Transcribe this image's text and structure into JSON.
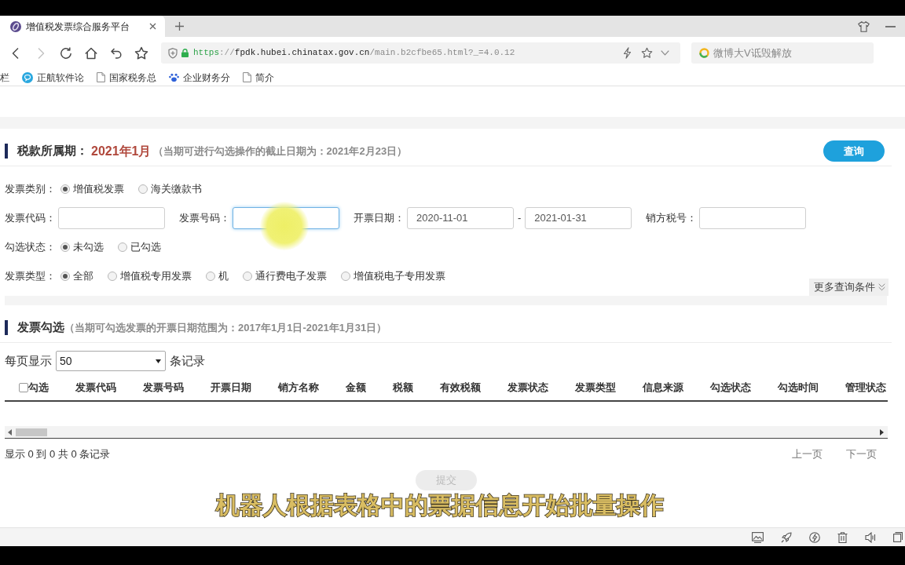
{
  "browser": {
    "tabs": [
      {
        "title": "增值税发票综合服务平台",
        "selected": true
      }
    ],
    "nav_buttons": [
      {
        "kind": "back",
        "disabled": false
      },
      {
        "kind": "forward",
        "disabled": true
      },
      {
        "kind": "reload",
        "disabled": false
      },
      {
        "kind": "home",
        "disabled": false
      },
      {
        "kind": "undo",
        "disabled": false
      },
      {
        "kind": "bookmark",
        "disabled": false
      }
    ],
    "address_bar": {
      "scheme": "https",
      "separator": "://",
      "host": "fpdk.hubei.chinatax.gov.cn",
      "path": "/main.b2cfbe65.html?_=4.0.12"
    },
    "search_box": {
      "placeholder": "微博大V诋毁解放"
    },
    "bookmarks": [
      {
        "kind": "text",
        "label": "栏"
      },
      {
        "kind": "chat",
        "label": "正航软件论"
      },
      {
        "kind": "page",
        "label": "国家税务总"
      },
      {
        "kind": "paw",
        "label": "企业财务分"
      },
      {
        "kind": "page",
        "label": "简介"
      }
    ]
  },
  "tax_period": {
    "label": "税款所属期：",
    "value": "2021年1月",
    "note": "（当期可进行勾选操作的截止日期为：2021年2月23日）",
    "query_button": "查询"
  },
  "filter_rows": [
    {
      "kind": "radio",
      "label": "发票类别：",
      "options": [
        {
          "label": "增值税发票",
          "selected": true
        },
        {
          "label": "海关缴款书",
          "selected": false
        }
      ]
    },
    {
      "kind": "inputs",
      "items": [
        {
          "kind": "field",
          "label": "发票代码：",
          "focused": false
        },
        {
          "kind": "field",
          "label": "发票号码：",
          "focused": true
        },
        {
          "kind": "field",
          "label": "开票日期：",
          "value": "2020-11-01",
          "focused": false
        },
        {
          "kind": "separator",
          "text": "-"
        },
        {
          "kind": "field",
          "value": "2021-01-31",
          "focused": false
        },
        {
          "kind": "field",
          "label": "销方税号：",
          "focused": false
        }
      ]
    },
    {
      "kind": "radio",
      "label": "勾选状态：",
      "options": [
        {
          "label": "未勾选",
          "selected": true
        },
        {
          "label": "已勾选",
          "selected": false
        }
      ]
    },
    {
      "kind": "radio",
      "label": "发票类型：",
      "options": [
        {
          "label": "全部",
          "selected": true
        },
        {
          "label": "增值税专用发票",
          "selected": false
        },
        {
          "label": "机",
          "selected": false
        },
        {
          "label": "通行费电子发票",
          "selected": false
        },
        {
          "label": "增值税电子专用发票",
          "selected": false
        }
      ]
    }
  ],
  "more_conditions_button": "更多查询条件",
  "invoice_selection": {
    "title": "发票勾选",
    "note": "（当期可勾选发票的开票日期范围为：2017年1月1日-2021年1月31日）",
    "page_size": {
      "prefix": "每页显示",
      "value": "50",
      "suffix": "条记录"
    },
    "table": {
      "select_all": {
        "label": "勾选",
        "checked": false
      },
      "columns": [
        "发票代码",
        "发票号码",
        "开票日期",
        "销方名称",
        "金额",
        "税额",
        "有效税额",
        "发票状态",
        "发票类型",
        "信息来源",
        "勾选状态",
        "勾选时间",
        "管理状态"
      ]
    },
    "summary": "显示 0 到 0 共 0 条记录",
    "pager": [
      "上一页",
      "下一页"
    ],
    "submit_button": {
      "label": "提交",
      "disabled": true
    }
  },
  "subtitle": "机器人根据表格中的票据信息开始批量操作"
}
